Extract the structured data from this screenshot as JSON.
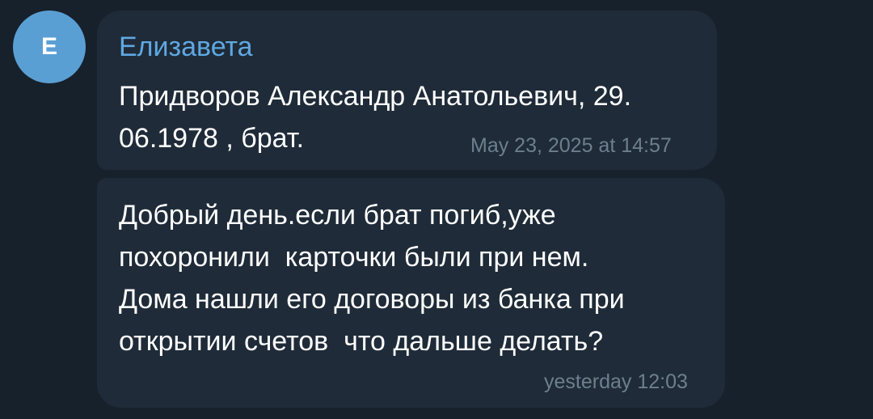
{
  "avatar": {
    "letter": "Е"
  },
  "messages": [
    {
      "sender": "Елизавета",
      "text": "Придворов Александр Анатольевич, 29.\n06.1978 , брат.",
      "time": "May 23, 2025 at 14:57"
    },
    {
      "text": "Добрый день.если брат погиб,уже\nпохоронили  карточки были при нем.\nДома нашли его договоры из банка при\nоткрытии счетов  что дальше делать?",
      "time": "yesterday 12:03"
    }
  ],
  "colors": {
    "background": "#17212b",
    "bubble": "#1f2b38",
    "avatar": "#5a9fd4",
    "sender_name": "#5fa8e2",
    "timestamp": "#6d7f8f"
  }
}
